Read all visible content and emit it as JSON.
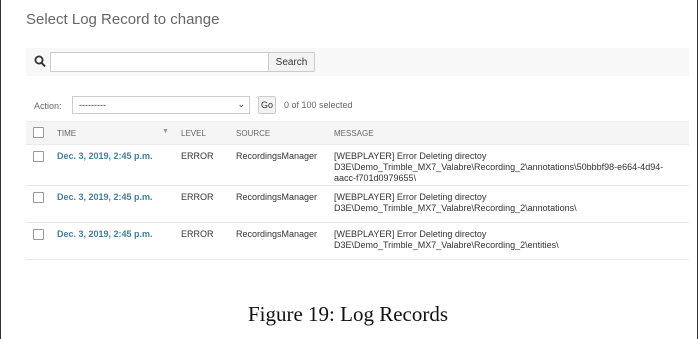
{
  "page": {
    "title": "Select Log Record to change"
  },
  "search": {
    "placeholder": "",
    "value": "",
    "button_label": "Search"
  },
  "actions": {
    "label": "Action:",
    "selected_option": "---------",
    "go_label": "Go",
    "selection_count": "0 of 100 selected"
  },
  "table": {
    "headers": {
      "time": "TIME",
      "level": "LEVEL",
      "source": "SOURCE",
      "message": "MESSAGE"
    },
    "rows": [
      {
        "time": "Dec. 3, 2019, 2:45 p.m.",
        "level": "ERROR",
        "source": "RecordingsManager",
        "message_lines": [
          "[WEBPLAYER] Error Deleting directoy",
          "D3E\\Demo_Trimble_MX7_Valabre\\Recording_2\\annotations\\50bbbf98-e664-4d94-",
          "aacc-f701d0979655\\"
        ]
      },
      {
        "time": "Dec. 3, 2019, 2:45 p.m.",
        "level": "ERROR",
        "source": "RecordingsManager",
        "message_lines": [
          "[WEBPLAYER] Error Deleting directoy",
          "D3E\\Demo_Trimble_MX7_Valabre\\Recording_2\\annotations\\"
        ]
      },
      {
        "time": "Dec. 3, 2019, 2:45 p.m.",
        "level": "ERROR",
        "source": "RecordingsManager",
        "message_lines": [
          "[WEBPLAYER] Error Deleting directoy",
          "D3E\\Demo_Trimble_MX7_Valabre\\Recording_2\\entities\\"
        ]
      }
    ]
  },
  "caption": "Figure 19: Log Records",
  "colors": {
    "link": "#447e9b",
    "title": "#666666"
  }
}
